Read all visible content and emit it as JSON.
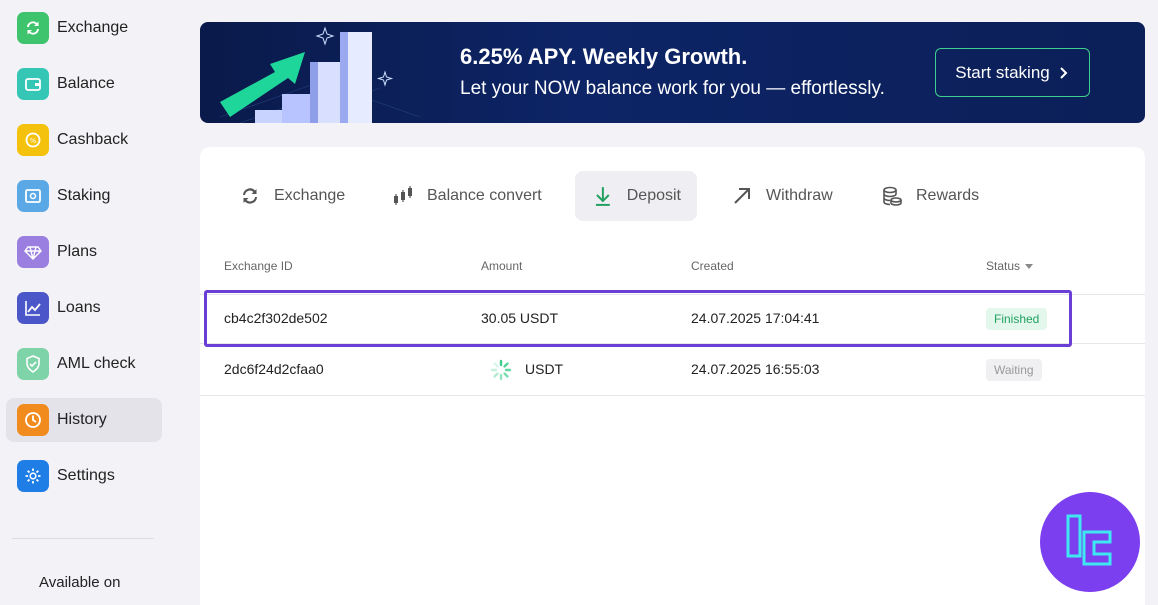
{
  "sidebar": {
    "items": [
      {
        "label": "Exchange",
        "icon": "exchange-icon",
        "color": "#3ec46d"
      },
      {
        "label": "Balance",
        "icon": "wallet-icon",
        "color": "#35c6b6"
      },
      {
        "label": "Cashback",
        "icon": "cashback-icon",
        "color": "#f4c20d"
      },
      {
        "label": "Staking",
        "icon": "safe-icon",
        "color": "#5aa8e6"
      },
      {
        "label": "Plans",
        "icon": "diamond-icon",
        "color": "#9b7fe0"
      },
      {
        "label": "Loans",
        "icon": "chart-icon",
        "color": "#4b56c8"
      },
      {
        "label": "AML check",
        "icon": "shield-icon",
        "color": "#7fd3a8"
      },
      {
        "label": "History",
        "icon": "clock-icon",
        "color": "#f28b1e"
      },
      {
        "label": "Settings",
        "icon": "gear-icon",
        "color": "#1e7ee6"
      }
    ],
    "active_index": 7,
    "available_on": "Available on"
  },
  "banner": {
    "title": "6.25% APY. Weekly Growth.",
    "subtitle": "Let your NOW balance work for you — effortlessly.",
    "button_label": "Start staking",
    "button_border": "#3ecf8e"
  },
  "tabs": [
    {
      "label": "Exchange",
      "icon": "exchange-arrows-icon"
    },
    {
      "label": "Balance convert",
      "icon": "candles-icon"
    },
    {
      "label": "Deposit",
      "icon": "download-arrow-icon",
      "active": true
    },
    {
      "label": "Withdraw",
      "icon": "arrow-up-right-icon"
    },
    {
      "label": "Rewards",
      "icon": "coins-icon"
    }
  ],
  "table": {
    "headers": {
      "id": "Exchange ID",
      "amount": "Amount",
      "created": "Created",
      "status": "Status"
    },
    "rows": [
      {
        "id": "cb4c2f302de502",
        "amount": "30.05 USDT",
        "created": "24.07.2025 17:04:41",
        "status": "Finished"
      },
      {
        "id": "2dc6f24d2cfaa0",
        "amount": "USDT",
        "created": "24.07.2025 16:55:03",
        "status": "Waiting"
      }
    ]
  },
  "colors": {
    "accent_green": "#22a060",
    "highlight": "#6a3fd6",
    "logo_bg": "#7b3ff0"
  }
}
